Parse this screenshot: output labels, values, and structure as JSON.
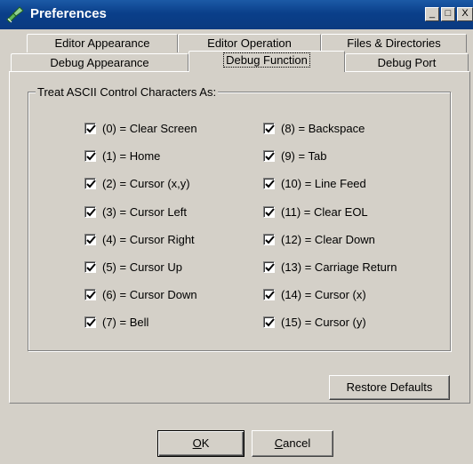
{
  "window": {
    "title": "Preferences"
  },
  "title_buttons": {
    "minimize": "_",
    "maximize": "□",
    "close": "X"
  },
  "tabs_back": [
    "Editor Appearance",
    "Editor Operation",
    "Files & Directories"
  ],
  "tabs_front": [
    "Debug Appearance",
    "Debug Function",
    "Debug Port"
  ],
  "active_tab": "Debug Function",
  "group": {
    "label": "Treat ASCII Control Characters As:",
    "left_column": [
      {
        "label": "(0) = Clear Screen",
        "checked": true
      },
      {
        "label": "(1) = Home",
        "checked": true
      },
      {
        "label": "(2) = Cursor (x,y)",
        "checked": true
      },
      {
        "label": "(3) = Cursor Left",
        "checked": true
      },
      {
        "label": "(4) = Cursor Right",
        "checked": true
      },
      {
        "label": "(5) = Cursor Up",
        "checked": true
      },
      {
        "label": "(6) = Cursor Down",
        "checked": true
      },
      {
        "label": "(7) = Bell",
        "checked": true
      }
    ],
    "right_column": [
      {
        "label": "(8) = Backspace",
        "checked": true
      },
      {
        "label": "(9) = Tab",
        "checked": true
      },
      {
        "label": "(10) = Line Feed",
        "checked": true
      },
      {
        "label": "(11) = Clear EOL",
        "checked": true
      },
      {
        "label": "(12) = Clear Down",
        "checked": true
      },
      {
        "label": "(13) = Carriage Return",
        "checked": true
      },
      {
        "label": "(14) = Cursor (x)",
        "checked": true
      },
      {
        "label": "(15) = Cursor (y)",
        "checked": true
      }
    ]
  },
  "buttons": {
    "restore_defaults": "Restore Defaults",
    "ok_prefix": "",
    "ok_underlined": "O",
    "ok_rest": "K",
    "cancel_underlined": "C",
    "cancel_rest": "ancel"
  },
  "colors": {
    "titlebar": "#0a3f8a",
    "face": "#d4d0c8"
  }
}
